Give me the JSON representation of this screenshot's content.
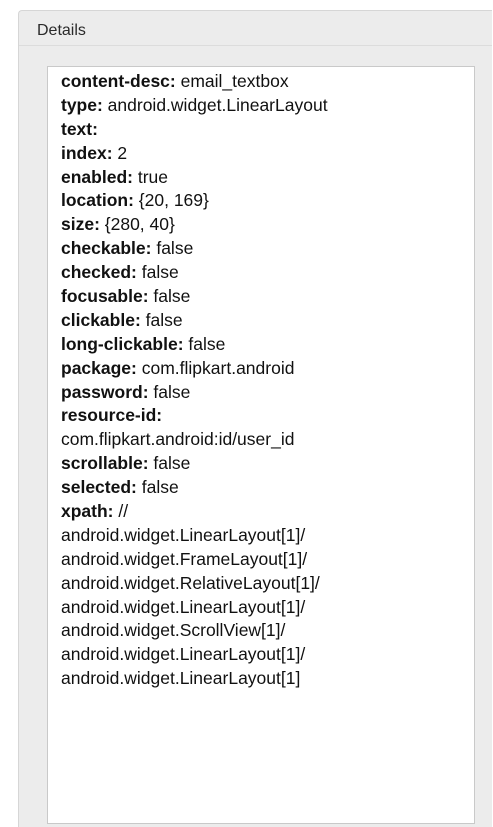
{
  "panel": {
    "title": "Details"
  },
  "properties": [
    {
      "key": "content-desc:",
      "value": " email_textbox"
    },
    {
      "key": "type:",
      "value": " android.widget.LinearLayout"
    },
    {
      "key": "text:",
      "value": ""
    },
    {
      "key": "index:",
      "value": " 2"
    },
    {
      "key": "enabled:",
      "value": " true"
    },
    {
      "key": "location:",
      "value": " {20, 169}"
    },
    {
      "key": "size:",
      "value": " {280, 40}"
    },
    {
      "key": "checkable:",
      "value": " false"
    },
    {
      "key": "checked:",
      "value": " false"
    },
    {
      "key": "focusable:",
      "value": " false"
    },
    {
      "key": "clickable:",
      "value": " false"
    },
    {
      "key": "long-clickable:",
      "value": " false"
    },
    {
      "key": "package:",
      "value": " com.flipkart.android"
    },
    {
      "key": "password:",
      "value": " false"
    },
    {
      "key": "resource-id:",
      "value": ""
    },
    {
      "key": "",
      "value": "com.flipkart.android:id/user_id"
    },
    {
      "key": "scrollable:",
      "value": " false"
    },
    {
      "key": "selected:",
      "value": " false"
    },
    {
      "key": "xpath:",
      "value": " //"
    },
    {
      "key": "",
      "value": "android.widget.LinearLayout[1]/"
    },
    {
      "key": "",
      "value": "android.widget.FrameLayout[1]/"
    },
    {
      "key": "",
      "value": "android.widget.RelativeLayout[1]/"
    },
    {
      "key": "",
      "value": "android.widget.LinearLayout[1]/"
    },
    {
      "key": "",
      "value": "android.widget.ScrollView[1]/"
    },
    {
      "key": "",
      "value": "android.widget.LinearLayout[1]/"
    },
    {
      "key": "",
      "value": "android.widget.LinearLayout[1]"
    }
  ]
}
